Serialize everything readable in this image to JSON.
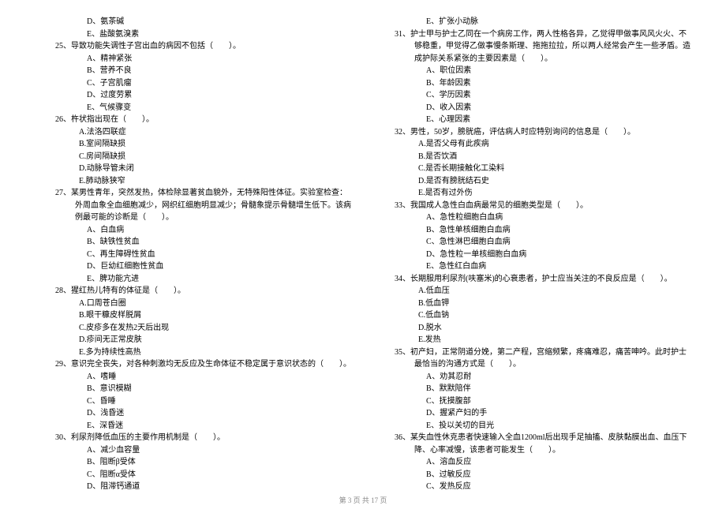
{
  "left_column": [
    {
      "type": "opt",
      "text": "D、氨茶碱"
    },
    {
      "type": "opt",
      "text": "E、盐酸氨溴素"
    },
    {
      "type": "q",
      "text": "25、导致功能失调性子宫出血的病因不包括（　　）。"
    },
    {
      "type": "opt",
      "text": "A、精神紧张"
    },
    {
      "type": "opt",
      "text": "B、营养不良"
    },
    {
      "type": "opt",
      "text": "C、子宫肌瘤"
    },
    {
      "type": "opt",
      "text": "D、过度劳累"
    },
    {
      "type": "opt",
      "text": "E、气候骤变"
    },
    {
      "type": "q",
      "text": "26、杵状指出现在（　　）。"
    },
    {
      "type": "opt2",
      "text": "A.法洛四联症"
    },
    {
      "type": "opt2",
      "text": "B.室间隔缺损"
    },
    {
      "type": "opt2",
      "text": "C.房间隔缺损"
    },
    {
      "type": "opt2",
      "text": "D.动脉导管未闭"
    },
    {
      "type": "opt2",
      "text": "E.肺动脉狭窄"
    },
    {
      "type": "q",
      "text": "27、某男性青年，突然发热，体检除显著贫血貌外，无特殊阳性体征。实验室检查：外周血象全血细胞减少，网织红细胞明显减少；骨髓象提示骨髓增生低下。该病例最可能的诊断是（　　）。"
    },
    {
      "type": "opt",
      "text": "A、白血病"
    },
    {
      "type": "opt",
      "text": "B、缺铁性贫血"
    },
    {
      "type": "opt",
      "text": "C、再生障碍性贫血"
    },
    {
      "type": "opt",
      "text": "D、巨幼红细胞性贫血"
    },
    {
      "type": "opt",
      "text": "E、脾功能亢进"
    },
    {
      "type": "q",
      "text": "28、猩红热儿特有的体征是（　　）。"
    },
    {
      "type": "opt2",
      "text": "A.口周苍白圈"
    },
    {
      "type": "opt2",
      "text": "B.眼干糠皮样脱屑"
    },
    {
      "type": "opt2",
      "text": "C.皮疹多在发热2天后出现"
    },
    {
      "type": "opt2",
      "text": "D.疹间无正常皮肤"
    },
    {
      "type": "opt2",
      "text": "E.多为持续性高热"
    },
    {
      "type": "q",
      "text": "29、意识完全丧失，对各种刺激均无反应及生命体征不稳定属于意识状态的（　　）。"
    },
    {
      "type": "opt",
      "text": "A、嗜睡"
    },
    {
      "type": "opt",
      "text": "B、意识模糊"
    },
    {
      "type": "opt",
      "text": "C、昏睡"
    },
    {
      "type": "opt",
      "text": "D、浅昏迷"
    },
    {
      "type": "opt",
      "text": "E、深昏迷"
    },
    {
      "type": "q",
      "text": "30、利尿剂降低血压的主要作用机制是（　　）。"
    },
    {
      "type": "opt",
      "text": "A、减少血容量"
    },
    {
      "type": "opt",
      "text": "B、阻断β受体"
    },
    {
      "type": "opt",
      "text": "C、阻断α受体"
    },
    {
      "type": "opt",
      "text": "D、阻滞钙通道"
    }
  ],
  "right_column": [
    {
      "type": "opt",
      "text": "E、扩张小动脉"
    },
    {
      "type": "q",
      "text": "31、护士甲与护士乙同在一个病房工作，两人性格各异，乙觉得甲做事风风火火、不够稳重，甲觉得乙做事慢条斯理、拖拖拉拉，所以两人经常会产生一些矛盾。造成护际关系紧张的主要因素是（　　）。"
    },
    {
      "type": "opt",
      "text": "A、职位因素"
    },
    {
      "type": "opt",
      "text": "B、年龄因素"
    },
    {
      "type": "opt",
      "text": "C、学历因素"
    },
    {
      "type": "opt",
      "text": "D、收入因素"
    },
    {
      "type": "opt",
      "text": "E、心理因素"
    },
    {
      "type": "q",
      "text": "32、男性，50岁，膀胱癌，评估病人时应特别询问的信息是（　　）。"
    },
    {
      "type": "opt2",
      "text": "A.是否父母有此疾病"
    },
    {
      "type": "opt2",
      "text": "B.是否饮酒"
    },
    {
      "type": "opt2",
      "text": "C.是否长期接触化工染料"
    },
    {
      "type": "opt2",
      "text": "D.是否有膀胱结石史"
    },
    {
      "type": "opt2",
      "text": "E.是否有过外伤"
    },
    {
      "type": "q",
      "text": "33、我国成人急性白血病最常见的细胞类型是（　　）。"
    },
    {
      "type": "opt",
      "text": "A、急性粒细胞白血病"
    },
    {
      "type": "opt",
      "text": "B、急性单核细胞白血病"
    },
    {
      "type": "opt",
      "text": "C、急性淋巴细胞白血病"
    },
    {
      "type": "opt",
      "text": "D、急性粒一单核细胞白血病"
    },
    {
      "type": "opt",
      "text": "E、急性红白血病"
    },
    {
      "type": "q",
      "text": "34、长期服用利尿剂(呋塞米)的心衰患者，护士应当关注的不良反应是（　　）。"
    },
    {
      "type": "opt2",
      "text": "A.低血压"
    },
    {
      "type": "opt2",
      "text": "B.低血钾"
    },
    {
      "type": "opt2",
      "text": "C.低血钠"
    },
    {
      "type": "opt2",
      "text": "D.脱水"
    },
    {
      "type": "opt2",
      "text": "E.发热"
    },
    {
      "type": "q",
      "text": "35、初产妇，正常阴道分娩，第二产程，宫缩频繁，疼痛难忍，痛苦呻吟。此时护士最恰当的沟通方式是（　　）。"
    },
    {
      "type": "opt",
      "text": "A、劝其忍耐"
    },
    {
      "type": "opt",
      "text": "B、默默陪伴"
    },
    {
      "type": "opt",
      "text": "C、抚摸腹部"
    },
    {
      "type": "opt",
      "text": "D、握紧产妇的手"
    },
    {
      "type": "opt",
      "text": "E、投以关切的目光"
    },
    {
      "type": "q",
      "text": "36、某失血性休克患者快速输入全血1200ml后出现手足抽搐、皮肤黏膜出血、血压下降、心率减慢，该患者可能发生（　　）。"
    },
    {
      "type": "opt",
      "text": "A、溶血反应"
    },
    {
      "type": "opt",
      "text": "B、过敏反应"
    },
    {
      "type": "opt",
      "text": "C、发热反应"
    }
  ],
  "footer": "第 3 页 共 17 页"
}
